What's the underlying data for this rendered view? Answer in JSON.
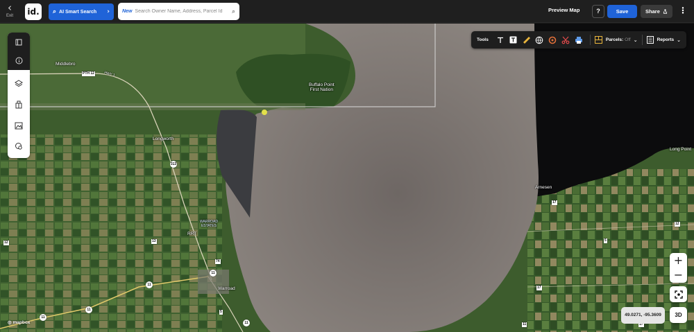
{
  "topbar": {
    "exit_label": "Exit",
    "logo_text": "id.",
    "ai_search_label": "AI Smart Search",
    "search_new_tag": "New",
    "search_placeholder": "Search Owner Name, Address, Parcel Id",
    "preview_label": "Preview Map",
    "help_label": "?",
    "save_label": "Save",
    "share_label": "Share"
  },
  "rail": {
    "icons": [
      "panel-toggle-icon",
      "info-icon",
      "layers-icon",
      "buildings-icon",
      "image-icon",
      "location-search-icon"
    ]
  },
  "tools": {
    "label": "Tools",
    "items": [
      "text-icon",
      "text-box-icon",
      "ruler-icon",
      "globe-pin-icon",
      "circle-icon",
      "scissors-icon",
      "print-icon"
    ],
    "parcels_label": "Parcels:",
    "parcels_state": "Off",
    "reports_label": "Reports"
  },
  "map": {
    "place_labels": {
      "middlebro": "Middlebro",
      "buffalo_point": "Buffalo Point\nFirst Nation",
      "longworth": "Longworth",
      "warroad_estates": "WARROAD\nESTATES",
      "rrt": "RRT",
      "warroad": "Warroad",
      "arnesen": "Arnesen",
      "long_point": "Long Point"
    },
    "road_labels": {
      "pth12": "PTH 12",
      "hwy_r1": "HWY 1",
      "r313": "313",
      "r74": "74",
      "r11a": "11",
      "r11b": "11",
      "r11c": "11",
      "r11d": "11",
      "r11e": "11",
      "r12": "12",
      "r13": "13",
      "r5": "5",
      "r17a": "17",
      "r17b": "17",
      "r12e": "12",
      "r5e": "5",
      "r11f": "11",
      "r17c": "17"
    },
    "attribution": "mapbox"
  },
  "controls": {
    "zoom_in": "+",
    "zoom_out": "−",
    "btn_3d": "3D",
    "coordinates": "49.0271, -95.3609"
  },
  "colors": {
    "accent": "#1f63d8",
    "topbar": "#1f1f1f",
    "lake": "#7d7672",
    "land": "#4a6b33"
  }
}
